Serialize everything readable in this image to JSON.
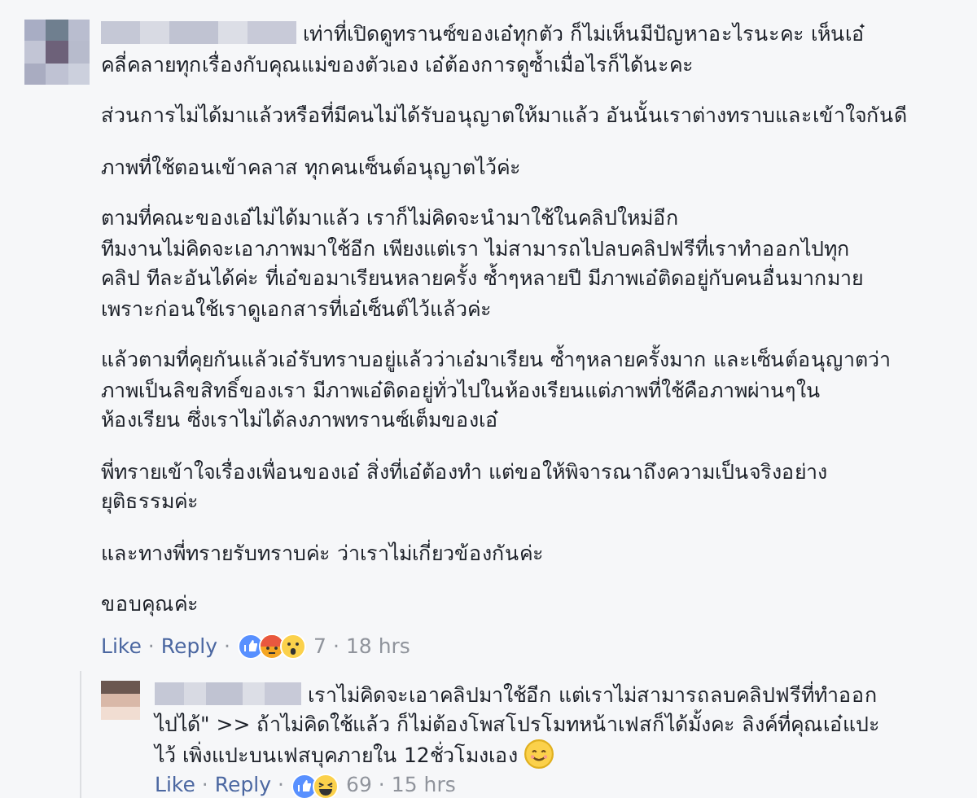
{
  "comment": {
    "name_hidden": true,
    "paragraphs": [
      [
        "เท่าที่เปิดดูทรานซ์ของเอ๋ทุกตัว ก็ไม่เห็นมีปัญหาอะไรนะคะ เห็นเอ๋",
        "คลี่คลายทุกเรื่องกับคุณแม่ของตัวเอง เอ๋ต้องการดูซ้ำเมื่อไรก็ได้นะคะ"
      ],
      [
        "ส่วนการไม่ได้มาแล้วหรือที่มีคนไม่ได้รับอนุญาตให้มาแล้ว อันนั้นเราต่างทราบและเข้าใจกันดี"
      ],
      [
        "ภาพที่ใช้ตอนเข้าคลาส ทุกคนเซ็นต์อนุญาตไว้ค่ะ"
      ],
      [
        "ตามที่คณะของเอ๋ไม่ได้มาแล้ว เราก็ไม่คิดจะนำมาใช้ในคลิปใหม่อีก",
        "ทีมงานไม่คิดจะเอาภาพมาใช้อีก เพียงแต่เรา ไม่สามารถไปลบคลิปฟรีที่เราทำออกไปทุก",
        "คลิป ทีละอันได้ค่ะ ที่เอ๋ขอมาเรียนหลายครั้ง ซ้ำๆหลายปี มีภาพเอ๋ติดอยู่กับคนอื่นมากมาย",
        "เพราะก่อนใช้เราดูเอกสารที่เอ๋เซ็นต์ไว้แล้วค่ะ"
      ],
      [
        "แล้วตามที่คุยกันแล้วเอ๋รับทราบอยู่แล้วว่าเอ๋มาเรียน ซ้ำๆหลายครั้งมาก และเซ็นต์อนุญาตว่า",
        "ภาพเป็นลิขสิทธิ์ของเรา มีภาพเอ๋ติดอยู่ทั่วไปในห้องเรียนแต่ภาพที่ใช้คือภาพผ่านๆใน",
        "ห้องเรียน ซึ่งเราไม่ได้ลงภาพทรานซ์เต็มของเอ๋"
      ],
      [
        "พี่ทรายเข้าใจเรื่องเพื่อนของเอ๋ สิ่งที่เอ๋ต้องทำ แต่ขอให้พิจารณาถึงความเป็นจริงอย่าง",
        "ยุติธรรมค่ะ"
      ],
      [
        "และทางพี่ทรายรับทราบค่ะ ว่าเราไม่เกี่ยวข้องกันค่ะ"
      ],
      [
        "ขอบคุณค่ะ"
      ]
    ],
    "actions": {
      "like": "Like",
      "reply": "Reply",
      "separator": "·",
      "reactions": [
        {
          "kind": "like"
        },
        {
          "kind": "angry"
        },
        {
          "kind": "wow"
        }
      ],
      "reaction_count": "7",
      "time": "18 hrs"
    },
    "replies": [
      {
        "name_hidden": true,
        "paragraphs": [
          [
            "เราไม่คิดจะเอาคลิปมาใช้อีก แต่เราไม่สามารถลบคลิปฟรีที่ทำออก",
            "ไปได้\" >> ถ้าไม่คิดใช้แล้ว ก็ไม่ต้องโพสโปรโมทหน้าเฟสก็ได้มั้งคะ ลิงค์ที่คุณเอ๋แปะ",
            "ไว้ เพิ่งแปะบนเฟสบุคภายใน 12ชั่วโมงเอง"
          ]
        ],
        "ends_with_smiley": true,
        "actions": {
          "like": "Like",
          "reply": "Reply",
          "separator": "·",
          "reactions": [
            {
              "kind": "like"
            },
            {
              "kind": "haha"
            }
          ],
          "reaction_count": "69",
          "time": "15 hrs"
        }
      }
    ]
  }
}
